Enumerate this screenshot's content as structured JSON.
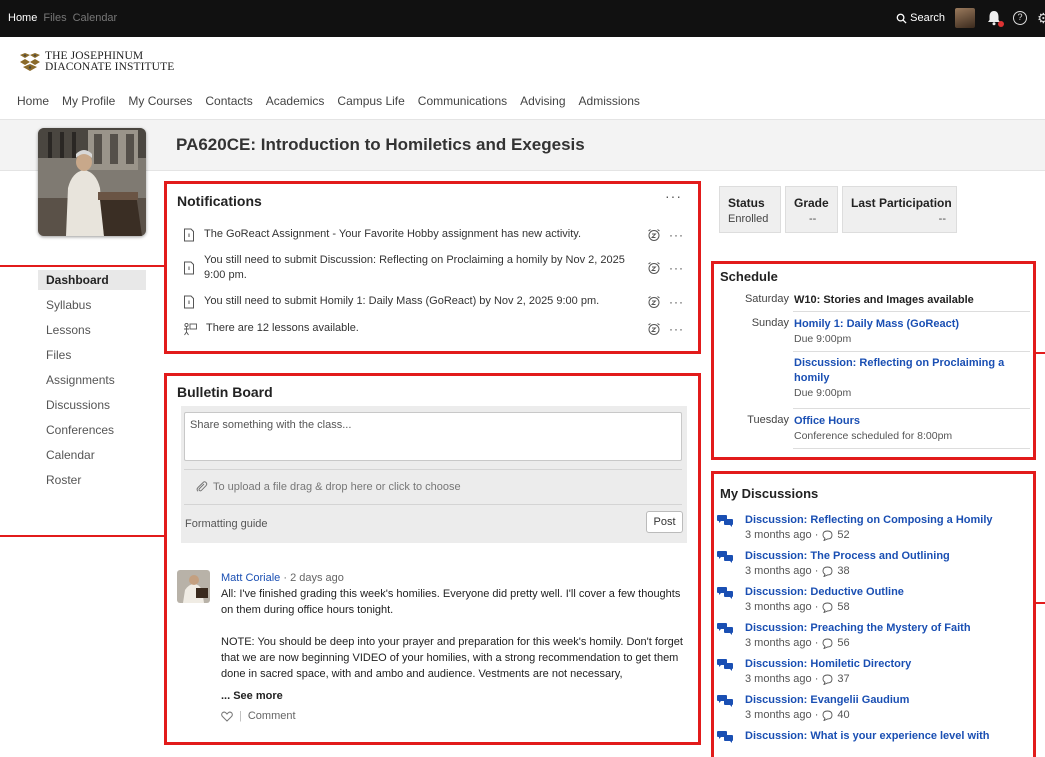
{
  "topbar": {
    "tabs": [
      "Home",
      "Files",
      "Calendar"
    ],
    "active_tab": 0,
    "search_label": "Search"
  },
  "logo": {
    "line1": "THE JOSEPHINUM",
    "line2": "DIACONATE INSTITUTE"
  },
  "main_nav": [
    "Home",
    "My Profile",
    "My Courses",
    "Contacts",
    "Academics",
    "Campus Life",
    "Communications",
    "Advising",
    "Admissions"
  ],
  "course": {
    "title": "PA620CE: Introduction to Homiletics and Exegesis"
  },
  "course_nav": [
    "Dashboard",
    "Syllabus",
    "Lessons",
    "Files",
    "Assignments",
    "Discussions",
    "Conferences",
    "Calendar",
    "Roster"
  ],
  "notifications": {
    "title": "Notifications",
    "items": [
      "The GoReact Assignment - Your Favorite Hobby assignment has new activity.",
      "You still need to submit Discussion: Reflecting on Proclaiming a homily by Nov 2, 2025 9:00 pm.",
      "You still need to submit Homily 1: Daily Mass (GoReact) by Nov 2, 2025 9:00 pm.",
      "There are 12 lessons available."
    ]
  },
  "bulletin": {
    "title": "Bulletin Board",
    "placeholder": "Share something with the class...",
    "upload_text": "To upload a file drag & drop here or click to choose",
    "guide": "Formatting guide",
    "post_button": "Post",
    "post": {
      "author": "Matt Coriale",
      "time": " · 2 days ago",
      "para1": "All: I've finished grading this week's homilies. Everyone did pretty well. I'll cover a few thoughts on them during office hours tonight.",
      "para2": "NOTE: You should be deep into your prayer and preparation for this week's homily. Don't forget that we are now beginning VIDEO of your homilies, with a strong recommendation to get them done in sacred space, with and ambo and audience. Vestments are not necessary,",
      "see_more": "... See more",
      "comment": "Comment",
      "separator": "|"
    }
  },
  "status": {
    "status_label": "Status",
    "status_value": "Enrolled",
    "grade_label": "Grade",
    "grade_value": "--",
    "last_label": "Last Participation",
    "last_value": "--"
  },
  "schedule": {
    "title": "Schedule",
    "rows": [
      {
        "day": "Saturday",
        "title": "W10: Stories and Images available",
        "sub": ""
      },
      {
        "day": "Sunday",
        "title": "Homily 1: Daily Mass (GoReact)",
        "sub": "Due 9:00pm"
      },
      {
        "day": "",
        "title": "Discussion: Reflecting on Proclaiming a homily",
        "sub": "Due 9:00pm"
      },
      {
        "day": "Tuesday",
        "title": "Office Hours",
        "sub": "Conference scheduled for 8:00pm"
      }
    ]
  },
  "discussions": {
    "title": "My Discussions",
    "items": [
      {
        "title": "Discussion: Reflecting on Composing a Homily",
        "ago": "3 months ago ·",
        "count": "52"
      },
      {
        "title": "Discussion: The Process and Outlining",
        "ago": "3 months ago ·",
        "count": "38"
      },
      {
        "title": "Discussion: Deductive Outline",
        "ago": "3 months ago ·",
        "count": "58"
      },
      {
        "title": "Discussion: Preaching the Mystery of Faith",
        "ago": "3 months ago ·",
        "count": "56"
      },
      {
        "title": "Discussion: Homiletic Directory",
        "ago": "3 months ago ·",
        "count": "37"
      },
      {
        "title": "Discussion: Evangelii Gaudium",
        "ago": "3 months ago ·",
        "count": "40"
      },
      {
        "title": "Discussion: What is your experience level with",
        "ago": "",
        "count": ""
      }
    ]
  },
  "colors": {
    "highlight": "#e21b1b",
    "link": "#1a4fb3",
    "topbar": "#111111"
  }
}
